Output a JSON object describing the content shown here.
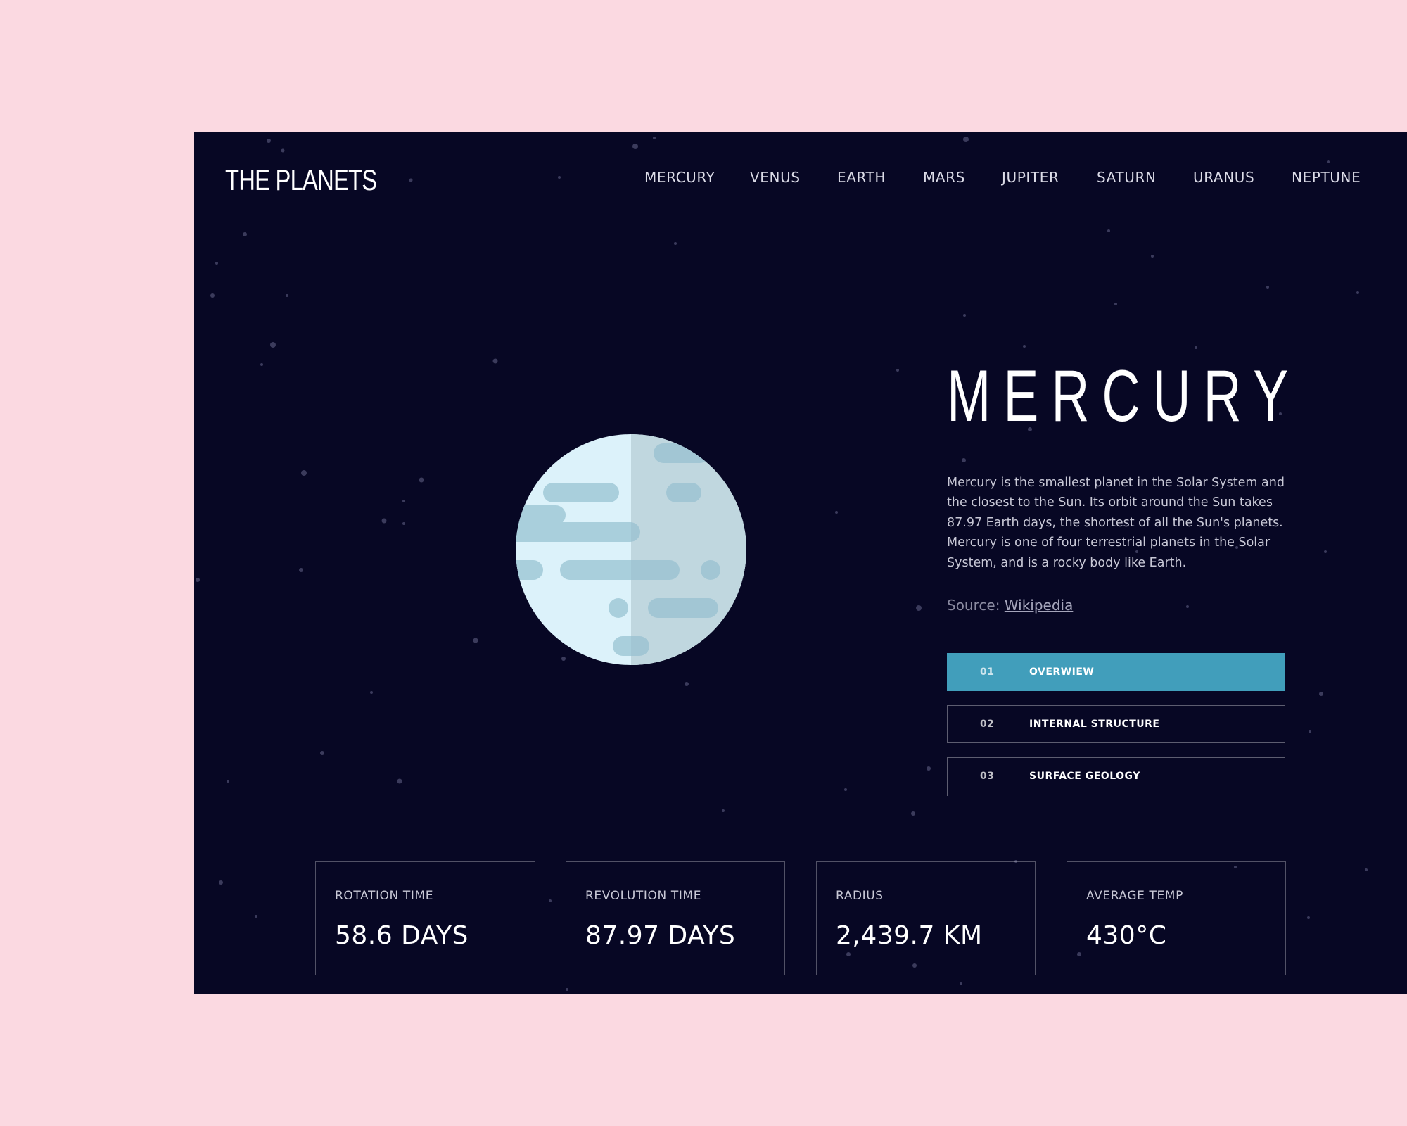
{
  "brand": {
    "logo": "THE PLANETS"
  },
  "nav": {
    "items": [
      "MERCURY",
      "VENUS",
      "EARTH",
      "MARS",
      "JUPITER",
      "SATURN",
      "URANUS",
      "NEPTUNE"
    ]
  },
  "planet": {
    "name": "MERCURY",
    "description": "Mercury is the smallest planet in the Solar System and the closest to the Sun. Its orbit around the Sun takes 87.97 Earth days, the shortest of all the Sun's planets. Mercury is one of four terrestrial planets in the Solar System, and is a rocky body like Earth.",
    "source_label": "Source:",
    "source_link": "Wikipedia",
    "illustration_icon": "mercury-planet-icon"
  },
  "tabs": [
    {
      "num": "01",
      "label": "OVERWIEW",
      "active": true
    },
    {
      "num": "02",
      "label": "INTERNAL STRUCTURE",
      "active": false
    },
    {
      "num": "03",
      "label": "SURFACE GEOLOGY",
      "active": false
    }
  ],
  "stats": [
    {
      "label": "ROTATION TIME",
      "value": "58.6 DAYS"
    },
    {
      "label": "REVOLUTION TIME",
      "value": "87.97 DAYS"
    },
    {
      "label": "RADIUS",
      "value": "2,439.7 KM"
    },
    {
      "label": "AVERAGE TEMP",
      "value": "430°C"
    }
  ],
  "colors": {
    "page_background": "#fbd9e1",
    "space_background": "#070724",
    "accent": "#419ebb",
    "planet_light": "#dcf2fa",
    "planet_shade": "#c8e0e8",
    "planet_spots": "#a9cfdc"
  }
}
